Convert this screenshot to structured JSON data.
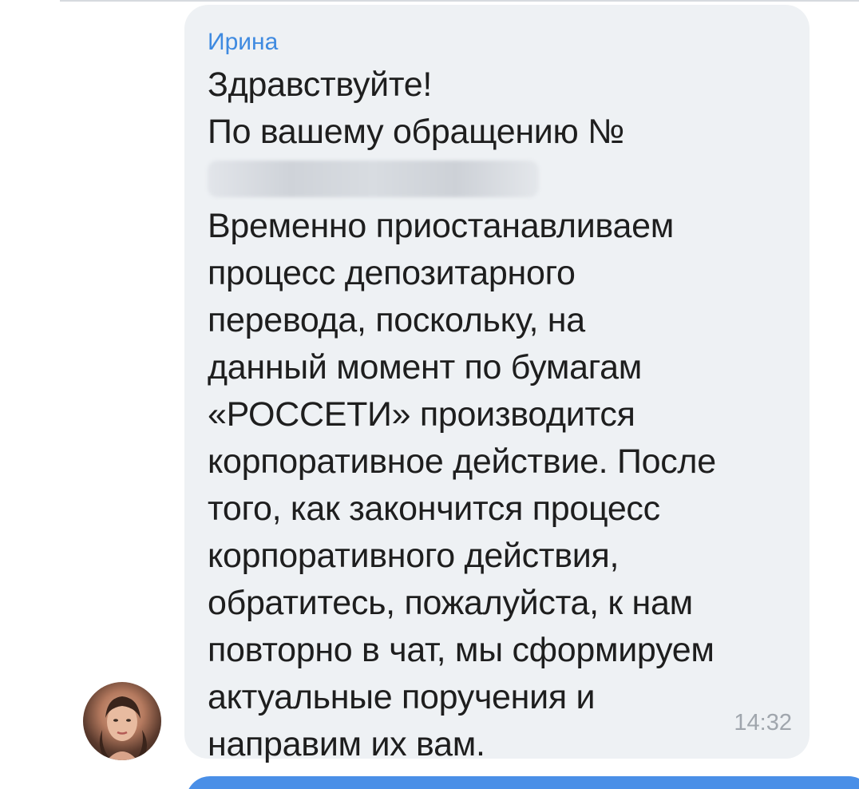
{
  "message": {
    "sender": "Ирина",
    "lines_before": [
      "Здравствуйте!",
      "По вашему обращению №"
    ],
    "lines_after": [
      "Временно приостанавливаем",
      "процесс депозитарного",
      "перевода, поскольку, на",
      "данный момент по бумагам",
      "«РОССЕТИ» производится",
      "корпоративное действие. После",
      "того, как закончится процесс",
      "корпоративного действия,",
      "обратитесь, пожалуйста, к нам",
      "повторно в чат, мы сформируем",
      "актуальные поручения и",
      "направим их вам."
    ],
    "time": "14:32"
  },
  "colors": {
    "bubble_incoming": "#eef1f4",
    "sender_name": "#3f8ae0",
    "timestamp": "#a0a6ad",
    "bubble_outgoing": "#4a8fe7"
  }
}
